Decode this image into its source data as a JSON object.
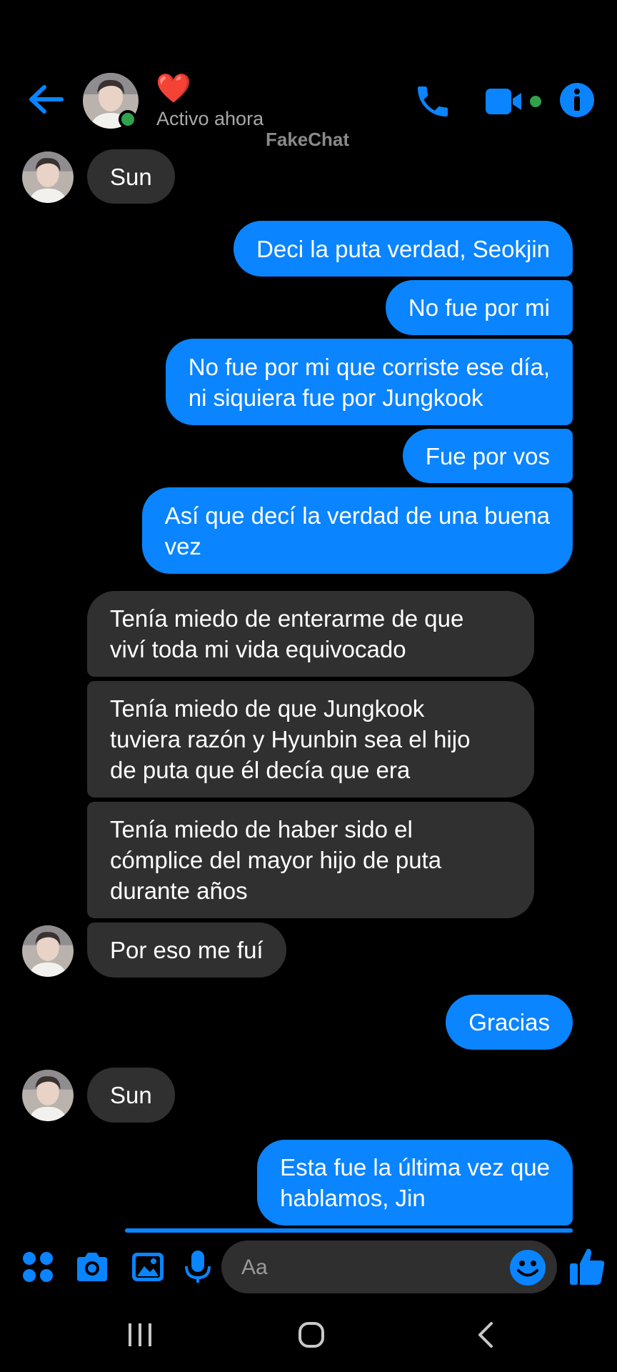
{
  "header": {
    "contact_name": "❤️",
    "status": "Activo ahora",
    "watermark": "FakeChat",
    "icons": [
      "back-arrow-icon",
      "phone-icon",
      "video-camera-icon",
      "info-icon"
    ]
  },
  "messages": [
    {
      "sender": "them",
      "text": "Sun"
    },
    {
      "sender": "me",
      "text": "Deci la puta verdad, Seokjin"
    },
    {
      "sender": "me",
      "text": "No fue por mi"
    },
    {
      "sender": "me",
      "text": "No fue por mi que corriste ese día,\nni siquiera fue por Jungkook"
    },
    {
      "sender": "me",
      "text": "Fue por vos"
    },
    {
      "sender": "me",
      "text": "Así que decí la verdad de una buena\nvez"
    },
    {
      "sender": "them",
      "text": "Tenía miedo de enterarme de que\nviví toda mi vida equivocado"
    },
    {
      "sender": "them",
      "text": "Tenía miedo de que Jungkook\ntuviera razón y Hyunbin sea el hijo\nde puta que él decía que era"
    },
    {
      "sender": "them",
      "text": "Tenía miedo de haber sido el\ncómplice del mayor hijo de puta\ndurante años"
    },
    {
      "sender": "them",
      "text": "Por eso me fuí"
    },
    {
      "sender": "me",
      "text": "Gracias"
    },
    {
      "sender": "them",
      "text": "Sun"
    },
    {
      "sender": "me",
      "text": "Esta fue la última vez que\nhablamos, Jin"
    }
  ],
  "composer": {
    "placeholder": "Aa",
    "icons": [
      "apps-icon",
      "camera-icon",
      "gallery-icon",
      "microphone-icon",
      "emoji-icon",
      "thumbs-up-icon"
    ]
  },
  "colors": {
    "accent": "#0a84ff",
    "incoming_bubble": "#303030",
    "online": "#31a24c",
    "background": "#000000"
  }
}
